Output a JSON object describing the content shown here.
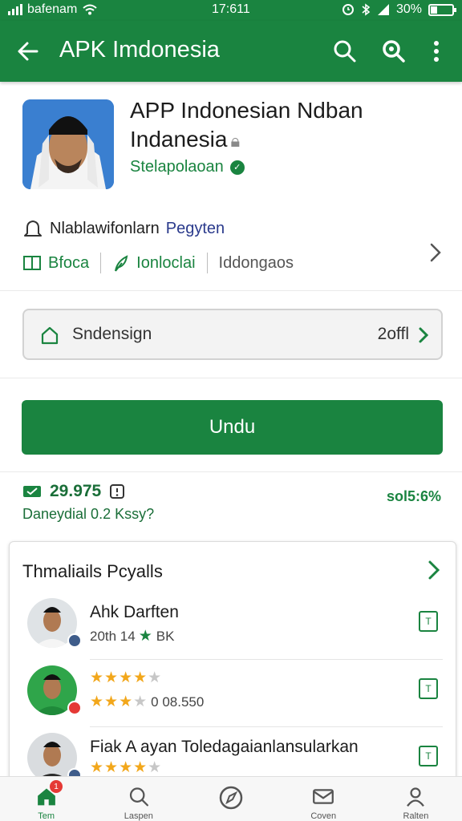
{
  "status_bar": {
    "carrier": "bafenam",
    "time": "17:611",
    "battery": "30%",
    "battery_level": 0.3
  },
  "app_bar": {
    "title": "APK Imdonesia",
    "icons": [
      "back-arrow-icon",
      "search-icon",
      "search-alt-icon",
      "more-vert-icon"
    ]
  },
  "app": {
    "name_line1": "APP Indonesian Ndban",
    "name_line2": "Indanesia",
    "developer": "Stelapolaoan",
    "info_prefix": "Nlablawifonlarn",
    "info_accent": "Pegyten",
    "tags": [
      "Bfoca",
      "Ionloclai",
      "Iddongaos"
    ]
  },
  "setting": {
    "label": "Sndensign",
    "value": "2offl"
  },
  "install": {
    "label": "Undu"
  },
  "stats": {
    "rating": "29.975",
    "subtitle": "Daneydial 0.2 Kssy?",
    "right": "sol5:6%"
  },
  "reviews": {
    "title": "Thmaliails Pcyalls",
    "items": [
      {
        "name": "Ahk Darften",
        "meta": "20th 14",
        "meta_suffix": "BK",
        "stars": 1,
        "action": "T"
      },
      {
        "name": "",
        "meta": "",
        "stars": 4,
        "stars_line2": 3,
        "meta_suffix": "0 08.550",
        "action": "T"
      },
      {
        "name": "Fiak A ayan Toledagaianlansularkan",
        "meta": "",
        "stars": 4,
        "action": "T"
      }
    ]
  },
  "bottom_nav": {
    "items": [
      {
        "label": "Tem",
        "icon": "home-icon",
        "badge": "1"
      },
      {
        "label": "Laspen",
        "icon": "search-icon"
      },
      {
        "label": "",
        "icon": "compass-icon"
      },
      {
        "label": "Coven",
        "icon": "mail-icon"
      },
      {
        "label": "Ralten",
        "icon": "profile-icon"
      }
    ]
  },
  "colors": {
    "primary": "#1a8440",
    "star": "#f2a71b"
  }
}
